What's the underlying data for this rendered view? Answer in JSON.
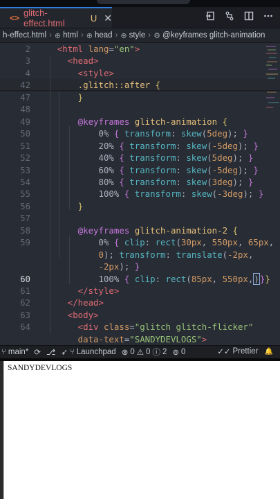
{
  "tab": {
    "icon": "<>",
    "filename": "glitch-effect.html",
    "status": "U",
    "close": "✕"
  },
  "tab_actions": [
    "split-editor-icon",
    "compare-icon",
    "split-icon",
    "more-icon"
  ],
  "breadcrumb": {
    "file": "h-effect.html",
    "items": [
      "html",
      "head",
      "style",
      "@keyframes glitch-animation"
    ]
  },
  "editor": {
    "lines": [
      {
        "n": "2",
        "tokens": [
          [
            "t-tag",
            "    <html "
          ],
          [
            "t-attr",
            "lang"
          ],
          [
            "t-pun",
            "="
          ],
          [
            "t-str",
            "\"en\""
          ],
          [
            "t-tag",
            ">"
          ]
        ]
      },
      {
        "n": "3",
        "tokens": [
          [
            "t-tag",
            "      <head>"
          ]
        ]
      },
      {
        "n": "4",
        "tokens": [
          [
            "t-tag",
            "        <style>"
          ]
        ]
      },
      {
        "n": "42",
        "tokens": [
          [
            "t-name",
            "        .glitch::after "
          ],
          [
            "t-br2",
            "{"
          ]
        ]
      },
      {
        "n": "47",
        "tokens": [
          [
            "t-br2",
            "        }"
          ]
        ]
      },
      {
        "n": "48",
        "tokens": []
      },
      {
        "n": "49",
        "tokens": [
          [
            "t-kw",
            "        @keyframes "
          ],
          [
            "t-name",
            "glitch-animation "
          ],
          [
            "t-br2",
            "{"
          ]
        ]
      },
      {
        "n": "50",
        "tokens": [
          [
            "t-pun",
            "            0% "
          ],
          [
            "t-br",
            "{ "
          ],
          [
            "t-fn",
            "transform"
          ],
          [
            "t-pun",
            ": "
          ],
          [
            "t-fn",
            "skew"
          ],
          [
            "t-pun",
            "("
          ],
          [
            "t-num",
            "5deg"
          ],
          [
            "t-pun",
            "); "
          ],
          [
            "t-br",
            "}"
          ]
        ]
      },
      {
        "n": "51",
        "tokens": [
          [
            "t-pun",
            "            20% "
          ],
          [
            "t-br",
            "{ "
          ],
          [
            "t-fn",
            "transform"
          ],
          [
            "t-pun",
            ": "
          ],
          [
            "t-fn",
            "skew"
          ],
          [
            "t-pun",
            "("
          ],
          [
            "t-num",
            "-5deg"
          ],
          [
            "t-pun",
            "); "
          ],
          [
            "t-br",
            "}"
          ]
        ]
      },
      {
        "n": "52",
        "tokens": [
          [
            "t-pun",
            "            40% "
          ],
          [
            "t-br",
            "{ "
          ],
          [
            "t-fn",
            "transform"
          ],
          [
            "t-pun",
            ": "
          ],
          [
            "t-fn",
            "skew"
          ],
          [
            "t-pun",
            "("
          ],
          [
            "t-num",
            "5deg"
          ],
          [
            "t-pun",
            "); "
          ],
          [
            "t-br",
            "}"
          ]
        ]
      },
      {
        "n": "53",
        "tokens": [
          [
            "t-pun",
            "            60% "
          ],
          [
            "t-br",
            "{ "
          ],
          [
            "t-fn",
            "transform"
          ],
          [
            "t-pun",
            ": "
          ],
          [
            "t-fn",
            "skew"
          ],
          [
            "t-pun",
            "("
          ],
          [
            "t-num",
            "-5deg"
          ],
          [
            "t-pun",
            "); "
          ],
          [
            "t-br",
            "}"
          ]
        ]
      },
      {
        "n": "54",
        "tokens": [
          [
            "t-pun",
            "            80% "
          ],
          [
            "t-br",
            "{ "
          ],
          [
            "t-fn",
            "transform"
          ],
          [
            "t-pun",
            ": "
          ],
          [
            "t-fn",
            "skew"
          ],
          [
            "t-pun",
            "("
          ],
          [
            "t-num",
            "3deg"
          ],
          [
            "t-pun",
            "); "
          ],
          [
            "t-br",
            "}"
          ]
        ]
      },
      {
        "n": "55",
        "tokens": [
          [
            "t-pun",
            "            100% "
          ],
          [
            "t-br",
            "{ "
          ],
          [
            "t-fn",
            "transform"
          ],
          [
            "t-pun",
            ": "
          ],
          [
            "t-fn",
            "skew"
          ],
          [
            "t-pun",
            "("
          ],
          [
            "t-num",
            "-3deg"
          ],
          [
            "t-pun",
            "); "
          ],
          [
            "t-br",
            "}"
          ]
        ]
      },
      {
        "n": "56",
        "tokens": [
          [
            "t-br2",
            "        }"
          ]
        ]
      },
      {
        "n": "57",
        "tokens": []
      },
      {
        "n": "58",
        "tokens": [
          [
            "t-kw",
            "        @keyframes "
          ],
          [
            "t-name",
            "glitch-animation-2 "
          ],
          [
            "t-br2",
            "{"
          ]
        ]
      },
      {
        "n": "59",
        "tokens": [
          [
            "t-pun",
            "            0% "
          ],
          [
            "t-br",
            "{ "
          ],
          [
            "t-fn",
            "clip"
          ],
          [
            "t-pun",
            ": "
          ],
          [
            "t-fn",
            "rect"
          ],
          [
            "t-pun",
            "("
          ],
          [
            "t-num",
            "30px"
          ],
          [
            "t-pun",
            ", "
          ],
          [
            "t-num",
            "550px"
          ],
          [
            "t-pun",
            ", "
          ],
          [
            "t-num",
            "65px"
          ],
          [
            "t-pun",
            ","
          ]
        ]
      },
      {
        "n": "",
        "tokens": [
          [
            "t-num",
            "            0"
          ],
          [
            "t-pun",
            "); "
          ],
          [
            "t-fn",
            "transform"
          ],
          [
            "t-pun",
            ": "
          ],
          [
            "t-fn",
            "translate"
          ],
          [
            "t-pun",
            "("
          ],
          [
            "t-num",
            "-2px"
          ],
          [
            "t-pun",
            ","
          ]
        ]
      },
      {
        "n": "",
        "tokens": [
          [
            "t-num",
            "            -2px"
          ],
          [
            "t-pun",
            "); "
          ],
          [
            "t-br",
            "}"
          ]
        ]
      },
      {
        "n": "60",
        "active": true,
        "tokens": [
          [
            "t-pun",
            "            100% "
          ],
          [
            "t-br",
            "{ "
          ],
          [
            "t-fn",
            "clip"
          ],
          [
            "t-pun",
            ": "
          ],
          [
            "t-fn",
            "rect"
          ],
          [
            "t-pun",
            "("
          ],
          [
            "t-num",
            "85px"
          ],
          [
            "t-pun",
            ", "
          ],
          [
            "t-num",
            "550px"
          ],
          [
            "t-pun",
            ","
          ],
          [
            "cursor",
            ")"
          ],
          [
            "t-br",
            "}"
          ],
          [
            "t-br2",
            "}"
          ]
        ]
      },
      {
        "n": "61",
        "tokens": [
          [
            "t-tag",
            "        </style>"
          ]
        ]
      },
      {
        "n": "62",
        "tokens": [
          [
            "t-tag",
            "      </head>"
          ]
        ]
      },
      {
        "n": "63",
        "tokens": [
          [
            "t-tag",
            "      <body>"
          ]
        ]
      },
      {
        "n": "64",
        "tokens": [
          [
            "t-tag",
            "        <div "
          ],
          [
            "t-attr",
            "class"
          ],
          [
            "t-pun",
            "="
          ],
          [
            "t-str",
            "\"glitch glitch-flicker\""
          ]
        ]
      },
      {
        "n": "",
        "tokens": [
          [
            "t-attr",
            "        data-text"
          ],
          [
            "t-pun",
            "="
          ],
          [
            "t-str",
            "\"SANDYDEVLOGS\""
          ],
          [
            "t-tag",
            ">"
          ]
        ]
      }
    ]
  },
  "statusbar": {
    "branch": "main*",
    "sync": "⟳",
    "launchpad": "Launchpad",
    "errors": "0",
    "warnings": "0",
    "info": "2",
    "ports": "0",
    "prettier": "Prettier",
    "bell": "🔔"
  },
  "preview": {
    "text": "SANDYDEVLOGS"
  }
}
